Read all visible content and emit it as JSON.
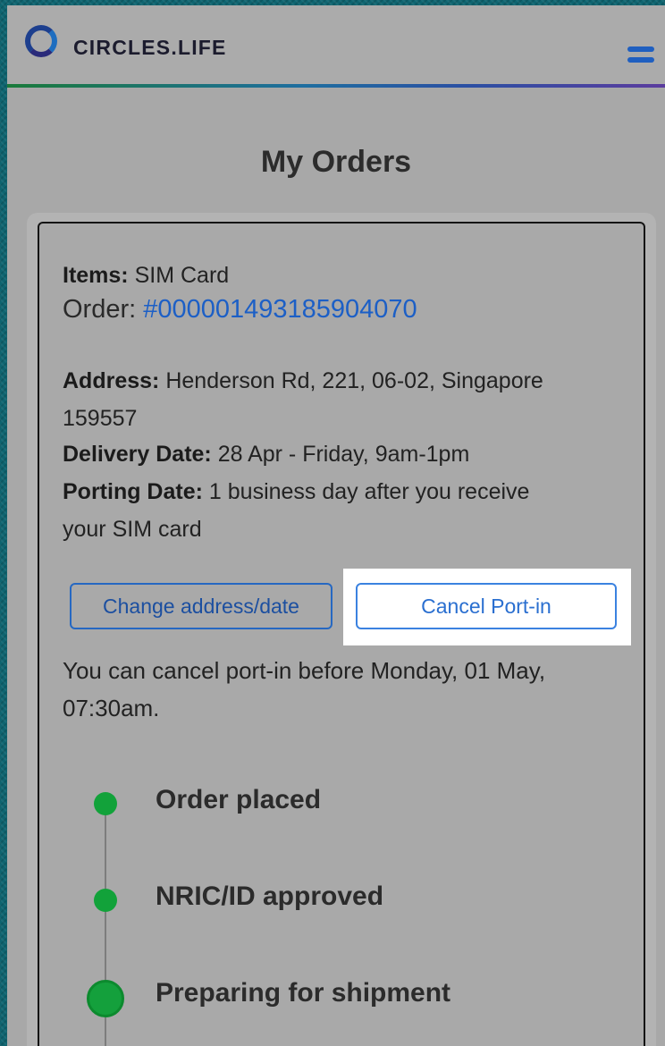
{
  "header": {
    "brand": "CIRCLES.LIFE",
    "menu_icon": "hamburger-menu-icon",
    "logo_icon": "circles-ring-logo"
  },
  "page": {
    "title": "My Orders"
  },
  "order": {
    "items_label": "Items:",
    "items_value": "SIM Card",
    "order_label": "Order:",
    "order_number": "#000001493185904070",
    "address_label": "Address:",
    "address_value_line1": "Henderson Rd, 221, 06-02, Singapore",
    "address_value_line2": "159557",
    "delivery_label": "Delivery Date:",
    "delivery_value": "28 Apr - Friday, 9am-1pm",
    "porting_label": "Porting Date:",
    "porting_value_line1": "1 business day after you receive",
    "porting_value_line2": "your SIM card",
    "change_button": "Change address/date",
    "cancel_button": "Cancel Port-in",
    "cancel_note_line1": "You can cancel port-in before Monday, 01 May,",
    "cancel_note_line2": "07:30am."
  },
  "timeline": {
    "steps": [
      {
        "label": "Order placed",
        "status": "done"
      },
      {
        "label": "NRIC/ID approved",
        "status": "done"
      },
      {
        "label": "Preparing for shipment",
        "status": "current"
      }
    ]
  },
  "colors": {
    "accent_blue": "#1c5fc6",
    "status_green": "#12a23a",
    "frame_teal": "#0e6470"
  }
}
